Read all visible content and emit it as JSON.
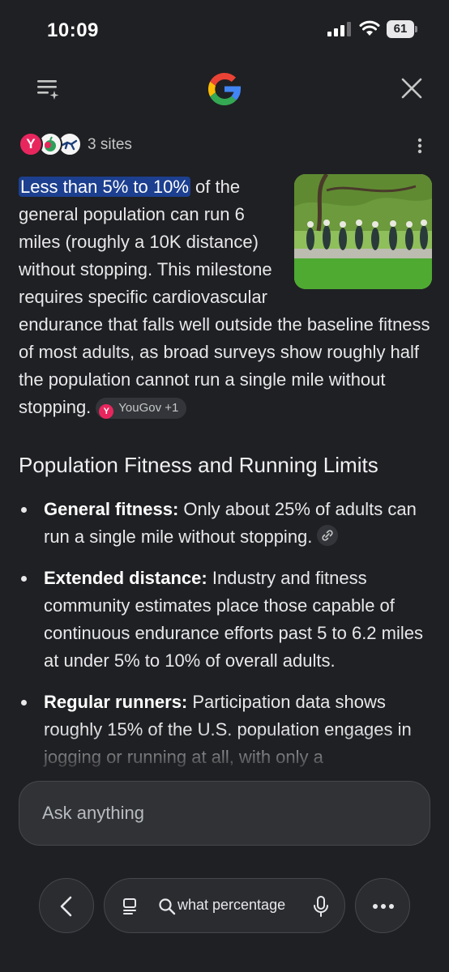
{
  "status_bar": {
    "time": "10:09",
    "battery": "61"
  },
  "sources": {
    "label": "3 sites",
    "first_favicon_letter": "Y"
  },
  "answer": {
    "highlight": "Less than 5% to 10%",
    "text": " of the general population can run 6 miles (roughly a 10K distance) without stopping. This milestone requires specific cardiovascular endurance that falls well outside the baseline fitness of most adults, as broad surveys show roughly half the population cannot run a single mile without stopping.",
    "citation": {
      "icon_letter": "Y",
      "label": "YouGov +1"
    }
  },
  "section": {
    "heading": "Population Fitness and Running Limits",
    "bullets": [
      {
        "bold": "General fitness:",
        "text": " Only about 25% of adults can run a single mile without stopping."
      },
      {
        "bold": "Extended distance:",
        "text": " Industry and fitness community estimates place those capable of continuous endurance efforts past 5 to 6.2 miles at under 5% to 10% of overall adults."
      },
      {
        "bold": "Regular runners:",
        "text": " Participation data shows roughly 15% of the U.S. population engages in jogging or running at all, with only a"
      }
    ]
  },
  "ask": {
    "placeholder": "Ask anything"
  },
  "bottom_nav": {
    "query": "what percentage"
  },
  "colors": {
    "highlight": "#1c3f8f",
    "background": "#1f2023",
    "brand_red": "#e8265e"
  }
}
